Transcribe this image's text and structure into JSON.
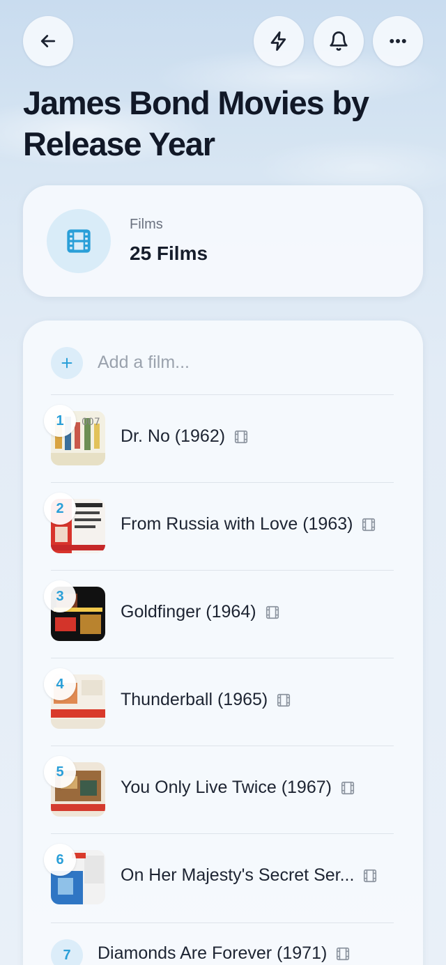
{
  "header": {
    "title": "James Bond Movies by Release Year",
    "icons": [
      "back-arrow-icon",
      "lightning-icon",
      "bell-icon",
      "more-horizontal-icon"
    ]
  },
  "summary": {
    "label": "Films",
    "value": "25 Films",
    "icon": "film-icon"
  },
  "list": {
    "add_placeholder": "Add a film...",
    "items": [
      {
        "rank": "1",
        "title": "Dr. No (1962)"
      },
      {
        "rank": "2",
        "title": "From Russia with Love (1963)"
      },
      {
        "rank": "3",
        "title": "Goldfinger (1964)"
      },
      {
        "rank": "4",
        "title": "Thunderball (1965)"
      },
      {
        "rank": "5",
        "title": "You Only Live Twice (1967)"
      },
      {
        "rank": "6",
        "title": "On Her Majesty's Secret Ser..."
      },
      {
        "rank": "7",
        "title": "Diamonds Are Forever (1971)"
      }
    ]
  },
  "colors": {
    "accent": "#2a9fd8",
    "accent_bg": "#dcedf9",
    "text": "#111827"
  }
}
